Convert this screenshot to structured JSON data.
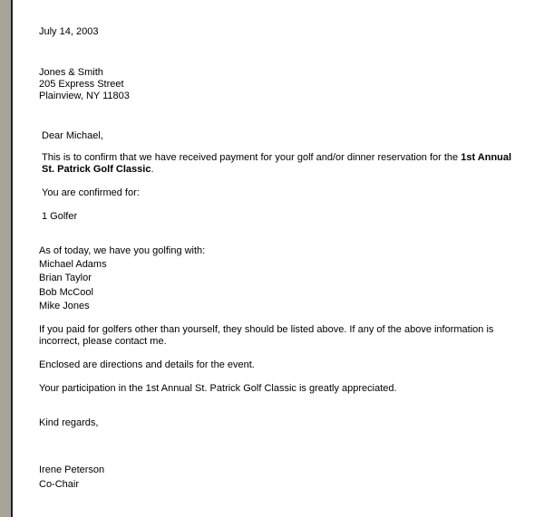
{
  "date": "July 14, 2003",
  "recipient": {
    "name": "Jones & Smith",
    "street": "205 Express Street",
    "city_line": "Plainview, NY 11803"
  },
  "salutation": "Dear Michael,",
  "confirmation": {
    "line1_prefix": "This is to confirm that we have received payment for your golf and/or dinner reservation for the ",
    "line1_bold": "1st Annual",
    "line2_bold": "St. Patrick Golf Classic",
    "line2_suffix": "."
  },
  "confirmed_for_label": "You are confirmed for:",
  "confirmed_item": "1 Golfer",
  "golfing_with_label": "As of today, we have you golfing with:",
  "golfers": [
    "Michael Adams",
    "Brian Taylor",
    "Bob McCool",
    "Mike Jones"
  ],
  "paid_notice": {
    "line1": "If you paid for golfers other than yourself, they should be listed above. If any of the above information is",
    "line2": "incorrect, please contact me."
  },
  "enclosed": "Enclosed are directions and details for the event.",
  "appreciation": "Your participation in the 1st Annual St. Patrick Golf Classic is greatly appreciated.",
  "closing": "Kind regards,",
  "signature": {
    "name": "Irene Peterson",
    "title": "Co-Chair"
  }
}
